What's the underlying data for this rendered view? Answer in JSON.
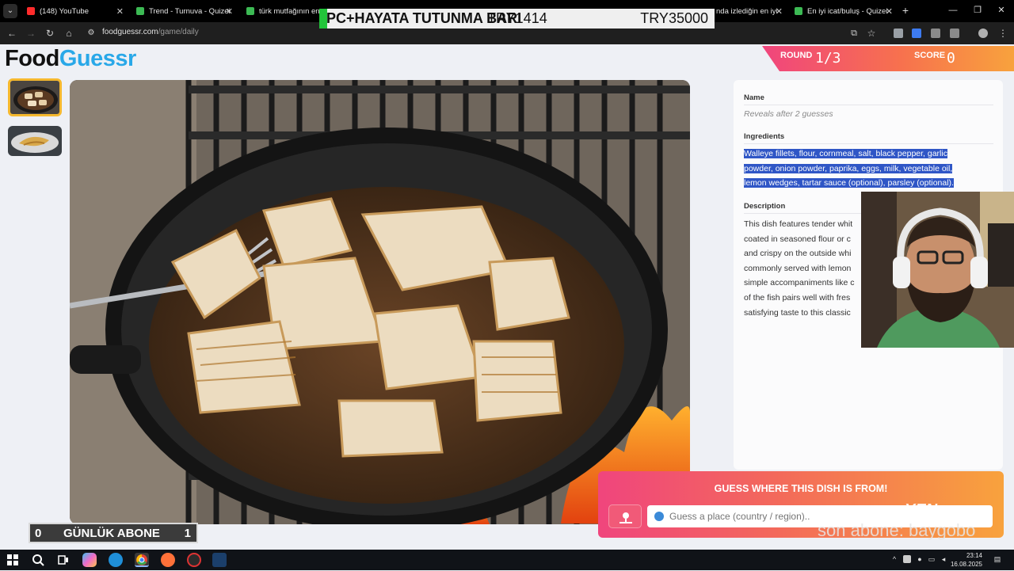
{
  "browser": {
    "tabs": [
      {
        "label": "(148) YouTube",
        "color": "#ff2b2b"
      },
      {
        "label": "Trend - Turnuva - Quizei",
        "color": "#3cba54"
      },
      {
        "label": "türk mutfağının en gü",
        "color": "#3cba54"
      },
      {
        "label": "nda izlediğin en iyi",
        "color": "#3cba54"
      },
      {
        "label": "En iyi icat/buluş - Quizei",
        "color": "#3cba54"
      }
    ],
    "url_host": "foodguessr.com",
    "url_path": "/game/daily"
  },
  "overlay": {
    "banner_left": "PC+HAYATA TUTUNMA BARI",
    "banner_mid": "TRY1414",
    "banner_right": "TRY35000",
    "abone_label": "GÜNLÜK ABONE",
    "abone_left": "0",
    "abone_right": "1",
    "son_abone": "son abone: baygobo",
    "brandmark": "YEN"
  },
  "header": {
    "logo_a": "Food",
    "logo_b": "Guessr",
    "round_label": "ROUND",
    "round_value": "1/3",
    "score_label": "SCORE",
    "score_value": "0"
  },
  "info": {
    "name_label": "Name",
    "name_value": "Reveals after 2 guesses",
    "ingredients_label": "Ingredients",
    "ingredients_lines": [
      "Walleye fillets, flour, cornmeal, salt, black pepper, garlic",
      "powder, onion powder, paprika, eggs, milk, vegetable oil,",
      "lemon wedges, tartar sauce (optional), parsley (optional)."
    ],
    "description_label": "Description",
    "description_lines": [
      "This dish features tender whit",
      "coated in seasoned flour or c",
      "and crispy on the outside whi",
      "commonly served with lemon",
      "simple accompaniments like c",
      "of the fish pairs well with fres",
      "satisfying taste to this classic"
    ]
  },
  "guess": {
    "title": "GUESS WHERE THIS DISH IS FROM!",
    "placeholder": "Guess a place (country / region).."
  },
  "taskbar": {
    "time": "23:14",
    "date": "16.08.2025"
  }
}
